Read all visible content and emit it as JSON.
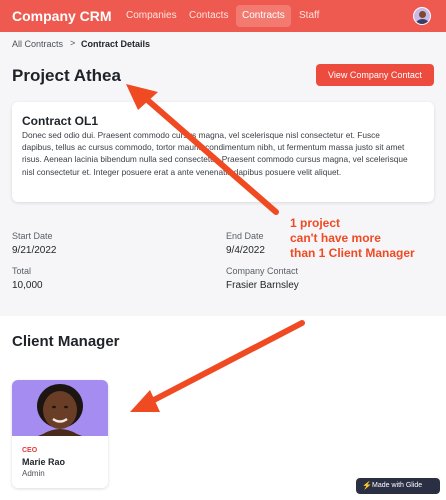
{
  "navbar": {
    "brand": "Company CRM",
    "tabs": [
      {
        "label": "Companies",
        "active": false
      },
      {
        "label": "Contacts",
        "active": false
      },
      {
        "label": "Contracts",
        "active": true
      },
      {
        "label": "Staff",
        "active": false
      }
    ]
  },
  "breadcrumb": {
    "parent": "All Contracts",
    "separator": ">",
    "current": "Contract Details"
  },
  "project": {
    "title": "Project Athea",
    "view_button": "View Company Contact"
  },
  "contract": {
    "title": "Contract OL1",
    "description": "Donec sed odio dui. Praesent commodo cursus magna, vel scelerisque nisl consectetur et. Fusce dapibus, tellus ac cursus commodo, tortor mauris condimentum nibh, ut fermentum massa justo sit amet risus. Aenean lacinia bibendum nulla sed consectetur. Praesent commodo cursus magna, vel scelerisque nisl consectetur et. Integer posuere erat a ante venenatis dapibus posuere velit aliquet."
  },
  "fields": {
    "start_date_label": "Start Date",
    "start_date": "9/21/2022",
    "end_date_label": "End Date",
    "end_date": "9/4/2022",
    "total_label": "Total",
    "total": "10,000",
    "company_contact_label": "Company Contact",
    "company_contact": "Frasier Barnsley"
  },
  "client_manager": {
    "section_title": "Client Manager",
    "role": "CEO",
    "name": "Marie Rao",
    "subtitle": "Admin"
  },
  "annotation": {
    "lines": [
      "1 project",
      "can't have more",
      "than 1 Client Manager"
    ],
    "color": "#f04a23"
  },
  "badge": {
    "label": "Made with Glide",
    "icon": "bolt-icon"
  },
  "colors": {
    "accent": "#ee5a50",
    "button": "#ee4b3f",
    "role": "#e23b3b"
  }
}
